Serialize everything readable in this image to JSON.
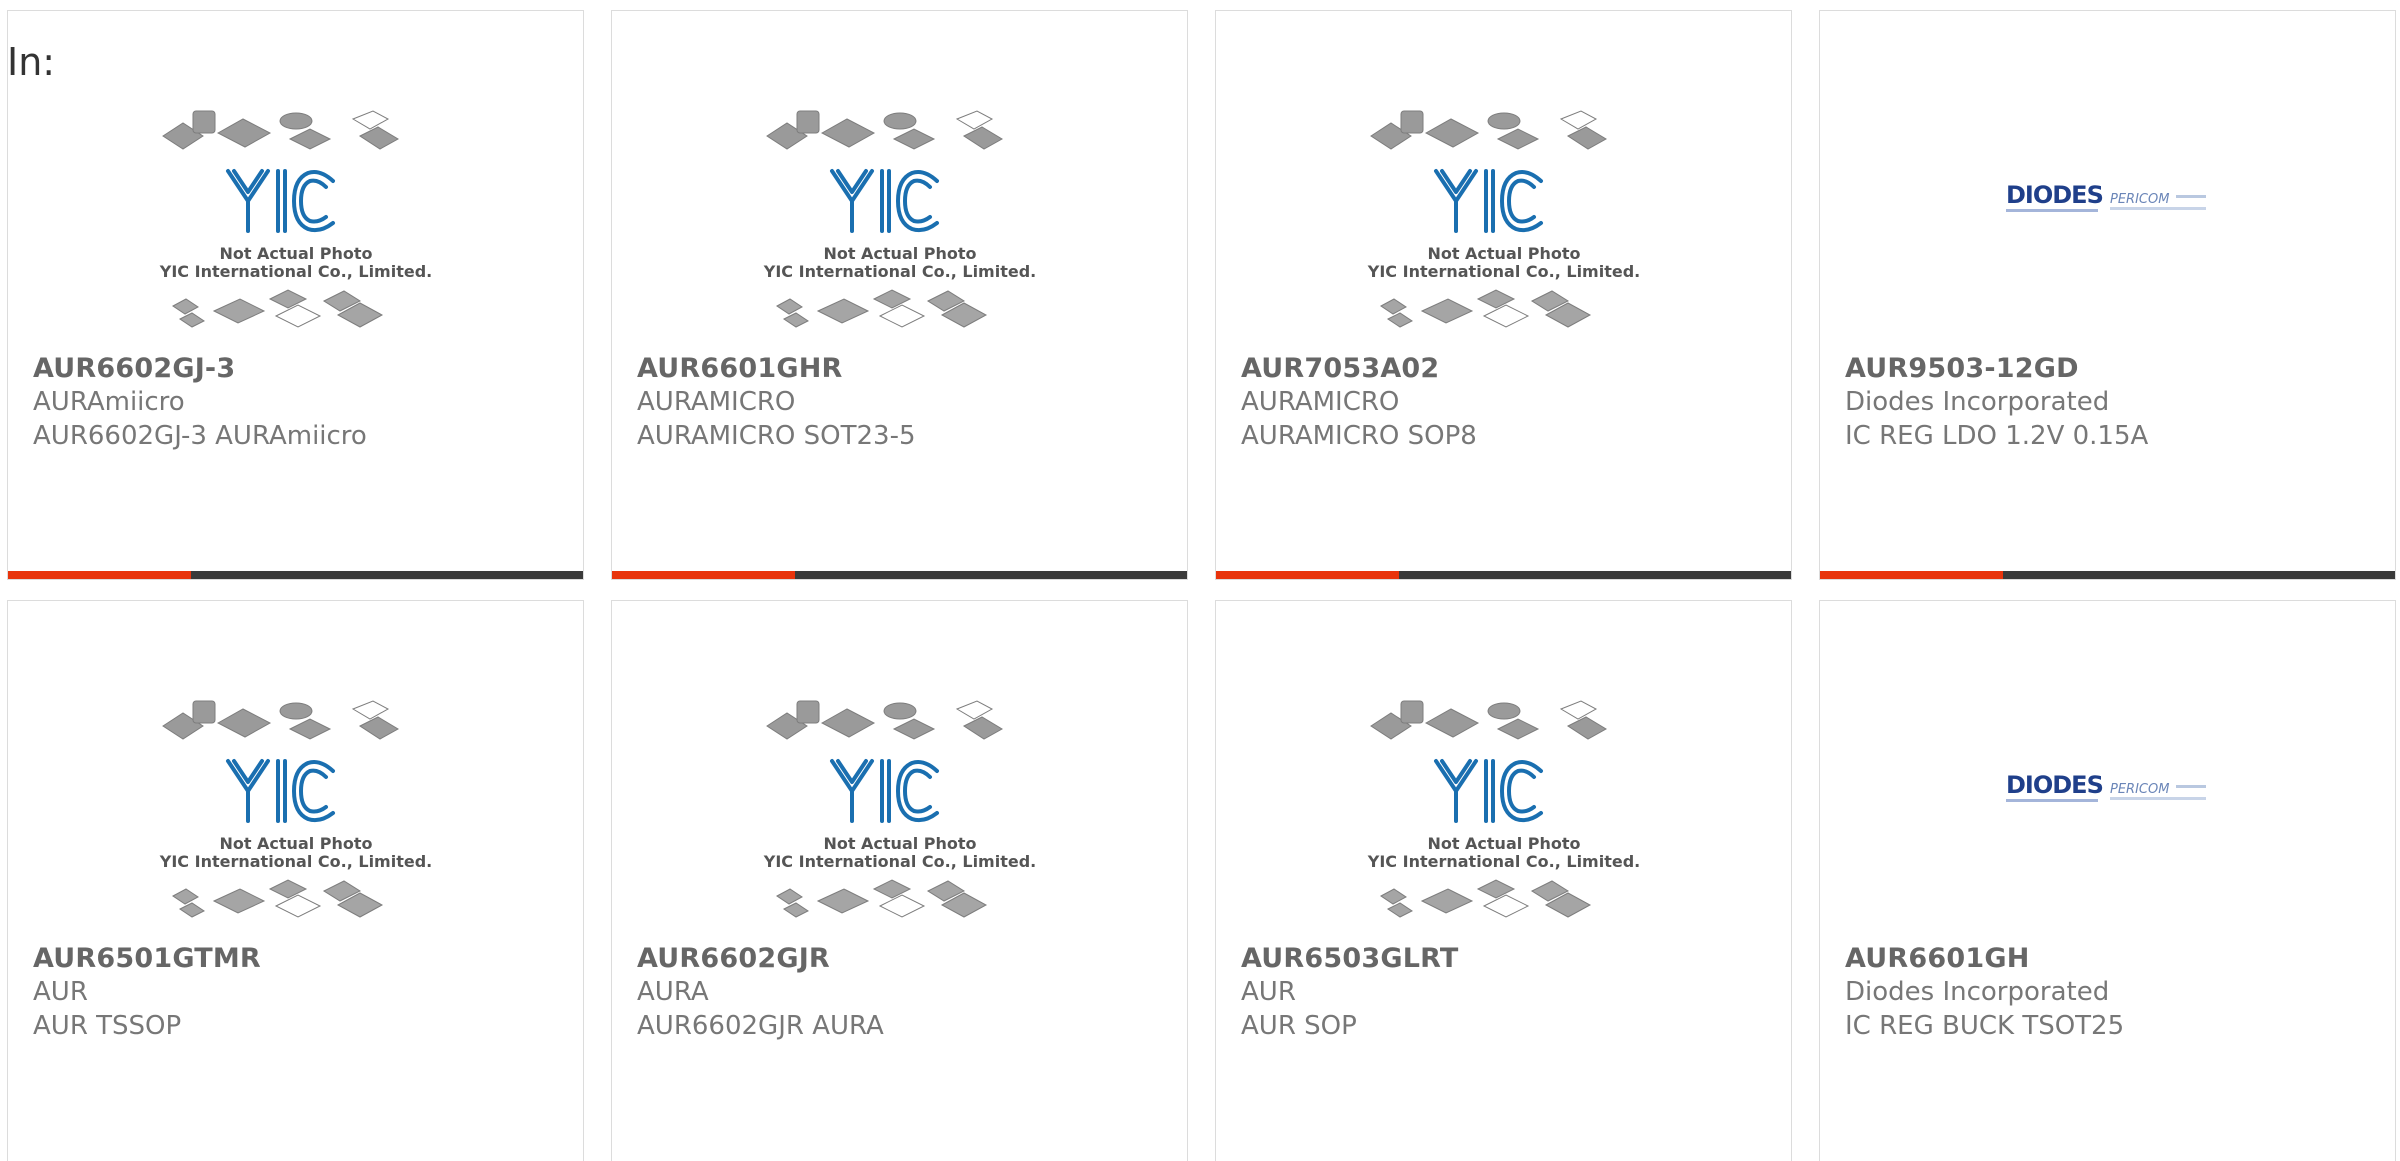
{
  "header": {
    "in_label": "In:"
  },
  "placeholder": {
    "caption_line1": "Not Actual Photo",
    "caption_line2": "YIC International Co., Limited.",
    "logo_text": "YIC"
  },
  "diodes_logo": {
    "brand": "DIODES",
    "sub_brand": "PERICOM"
  },
  "colors": {
    "accent": "#e8340c",
    "bar_dark": "#3a3a3a",
    "yic_blue": "#1a6fb0"
  },
  "products": [
    {
      "part": "AUR6602GJ-3",
      "maker": "AURAmiicro",
      "desc": "AUR6602GJ-3 AURAmiicro",
      "image": "yic-placeholder"
    },
    {
      "part": "AUR6601GHR",
      "maker": "AURAMICRO",
      "desc": "AURAMICRO SOT23-5",
      "image": "yic-placeholder"
    },
    {
      "part": "AUR7053A02",
      "maker": "AURAMICRO",
      "desc": "AURAMICRO SOP8",
      "image": "yic-placeholder"
    },
    {
      "part": "AUR9503-12GD",
      "maker": "Diodes Incorporated",
      "desc": "IC REG LDO 1.2V 0.15A",
      "image": "diodes-logo"
    },
    {
      "part": "AUR6501GTMR",
      "maker": "AUR",
      "desc": "AUR TSSOP",
      "image": "yic-placeholder"
    },
    {
      "part": "AUR6602GJR",
      "maker": "AURA",
      "desc": "AUR6602GJR AURA",
      "image": "yic-placeholder"
    },
    {
      "part": "AUR6503GLRT",
      "maker": "AUR",
      "desc": "AUR SOP",
      "image": "yic-placeholder"
    },
    {
      "part": "AUR6601GH",
      "maker": "Diodes Incorporated",
      "desc": "IC REG BUCK TSOT25",
      "image": "diodes-logo"
    }
  ]
}
